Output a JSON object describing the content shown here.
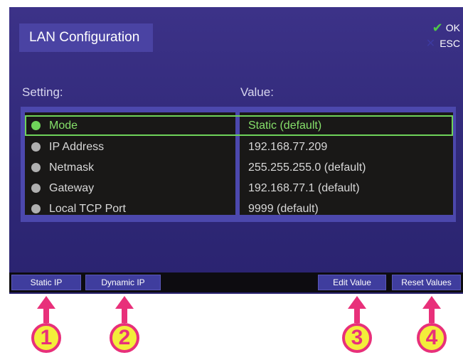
{
  "window": {
    "title": "LAN Configuration",
    "ok_label": "OK",
    "esc_label": "ESC"
  },
  "table": {
    "setting_header": "Setting:",
    "value_header": "Value:",
    "rows": [
      {
        "setting": "Mode",
        "value": "Static (default)",
        "selected": true
      },
      {
        "setting": "IP Address",
        "value": "192.168.77.209",
        "selected": false
      },
      {
        "setting": "Netmask",
        "value": "255.255.255.0 (default)",
        "selected": false
      },
      {
        "setting": "Gateway",
        "value": "192.168.77.1 (default)",
        "selected": false
      },
      {
        "setting": "Local TCP Port",
        "value": "9999 (default)",
        "selected": false
      }
    ]
  },
  "softkeys": {
    "static_ip": "Static IP",
    "dynamic_ip": "Dynamic IP",
    "edit_value": "Edit Value",
    "reset_values": "Reset Values"
  },
  "callouts": [
    "1",
    "2",
    "3",
    "4"
  ],
  "colors": {
    "screen_bg": "#2f2876",
    "highlight": "#6fd35a",
    "callout_fill": "#f3ee3a",
    "callout_accent": "#e8307a"
  },
  "icons": {
    "ok": "check-icon",
    "esc": "x-icon",
    "row_bullet": "dot-icon",
    "callout_arrow": "arrow-up-icon"
  }
}
